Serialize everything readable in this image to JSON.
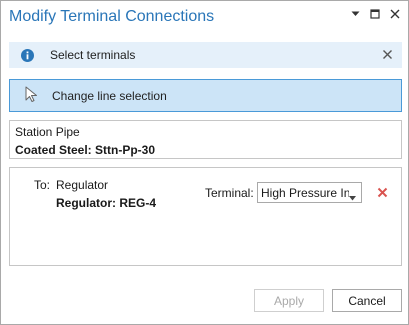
{
  "window": {
    "title": "Modify Terminal Connections"
  },
  "icons": {
    "options": "chevron-down-icon",
    "restore": "restore-icon",
    "close": "close-icon",
    "info": "info-icon",
    "dismiss": "close-icon",
    "cursor": "arrow-cursor-icon",
    "remove": "red-x-icon"
  },
  "colors": {
    "title": "#2a76b8",
    "info_bar_bg": "#e5f0fa",
    "selection_bg": "#cce4f7",
    "selection_border": "#4a9ad8",
    "remove": "#d9534f"
  },
  "info_bar": {
    "message": "Select terminals"
  },
  "change_selection": {
    "label": "Change line selection"
  },
  "feature": {
    "type": "Station Pipe",
    "name": "Coated Steel: Sttn-Pp-30"
  },
  "connection": {
    "to_label": "To:",
    "to_type": "Regulator",
    "to_name": "Regulator: REG-4",
    "terminal_label": "Terminal:",
    "terminal_value": "High Pressure In"
  },
  "buttons": {
    "apply": "Apply",
    "cancel": "Cancel"
  }
}
